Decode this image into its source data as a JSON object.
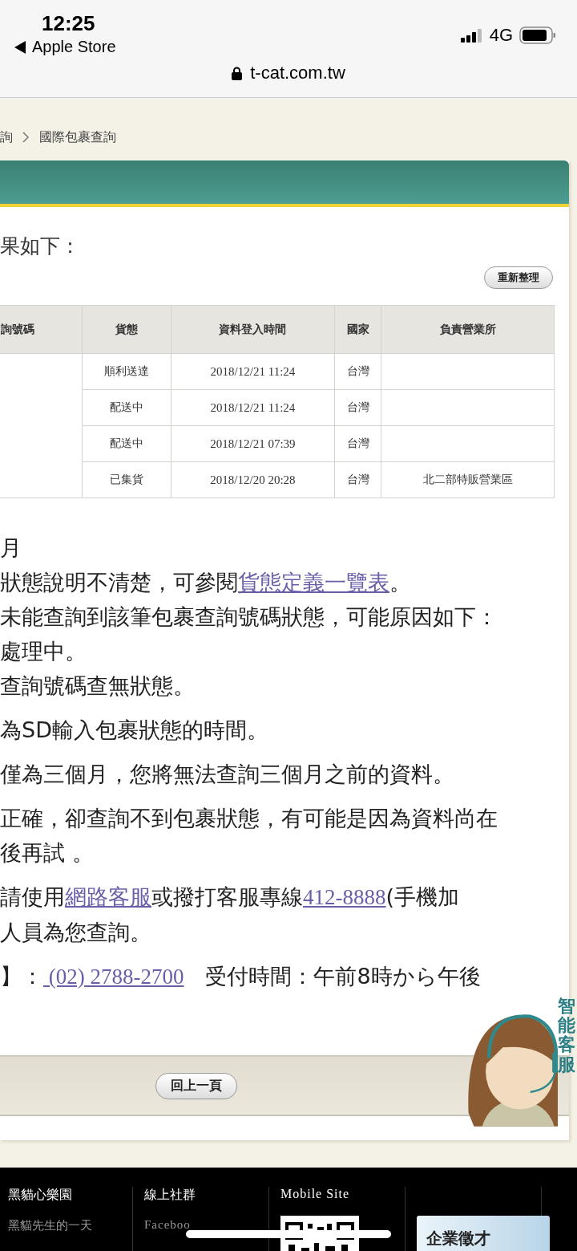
{
  "status_bar": {
    "time": "12:25",
    "back_app": "Apple Store",
    "network": "4G"
  },
  "address_bar": {
    "url": "t-cat.com.tw"
  },
  "breadcrumb": [
    {
      "label": "詢"
    },
    {
      "label": "國際包裹查詢"
    }
  ],
  "result_heading": "果如下：",
  "refresh_button": "重新整理",
  "table": {
    "columns": [
      "詢號碼",
      "貨態",
      "資料登入時間",
      "國家",
      "負責營業所"
    ],
    "rows": [
      {
        "status": "順利送達",
        "time": "2018/12/21 11:24",
        "country": "台灣"
      },
      {
        "status": "配送中",
        "time": "2018/12/21 11:24",
        "country": "台灣"
      },
      {
        "status": "配送中",
        "time": "2018/12/21 07:39",
        "country": "台灣"
      },
      {
        "status": "已集貨",
        "time": "2018/12/20 20:28",
        "country": "台灣",
        "office": "北二部特販營業區"
      }
    ]
  },
  "notes": [
    {
      "lines": [
        [
          {
            "text": "月"
          }
        ],
        [
          {
            "text": "狀態說明不清楚，可參閱"
          },
          {
            "text": "貨態定義一覽表",
            "link": true
          },
          {
            "text": "。"
          }
        ],
        [
          {
            "text": "未能查詢到該筆包裹查詢號碼狀態，可能原因如下："
          }
        ],
        [
          {
            "text": "處理中。"
          }
        ],
        [
          {
            "text": "查詢號碼查無狀態。"
          }
        ]
      ]
    },
    {
      "lines": [
        [
          {
            "text": "為SD輸入包裹狀態的時間。"
          }
        ]
      ]
    },
    {
      "lines": [
        [
          {
            "text": "僅為三個月，您將無法查詢三個月之前的資料。"
          }
        ]
      ]
    },
    {
      "lines": [
        [
          {
            "text": "正確，卻查詢不到包裹狀態，有可能是因為資料尚在"
          }
        ],
        [
          {
            "text": "後再試 。"
          }
        ]
      ]
    },
    {
      "lines": [
        [
          {
            "text": "請使用"
          },
          {
            "text": "網路客服",
            "link": true
          },
          {
            "text": "或撥打客服專線"
          },
          {
            "text": "412-8888",
            "link": true
          },
          {
            "text": "(手機加"
          }
        ],
        [
          {
            "text": "人員為您查詢。"
          }
        ]
      ]
    },
    {
      "lines": [
        [
          {
            "text": "】："
          },
          {
            "text": " (02) 2788-2700",
            "link": true
          },
          {
            "text": "　受付時間：午前8時から午後"
          }
        ]
      ]
    }
  ],
  "back_button": "回上一頁",
  "chat_widget": {
    "label": "智能客服"
  },
  "footer": {
    "columns": [
      {
        "heading": "黑貓心樂園",
        "links": [
          "黑貓先生的一天"
        ]
      },
      {
        "heading": "線上社群",
        "links": [
          "Faceboo"
        ]
      },
      {
        "heading": "Mobile Site",
        "kind": "qr"
      },
      {
        "kind": "banner",
        "banner_text": "企業徵才"
      }
    ]
  }
}
